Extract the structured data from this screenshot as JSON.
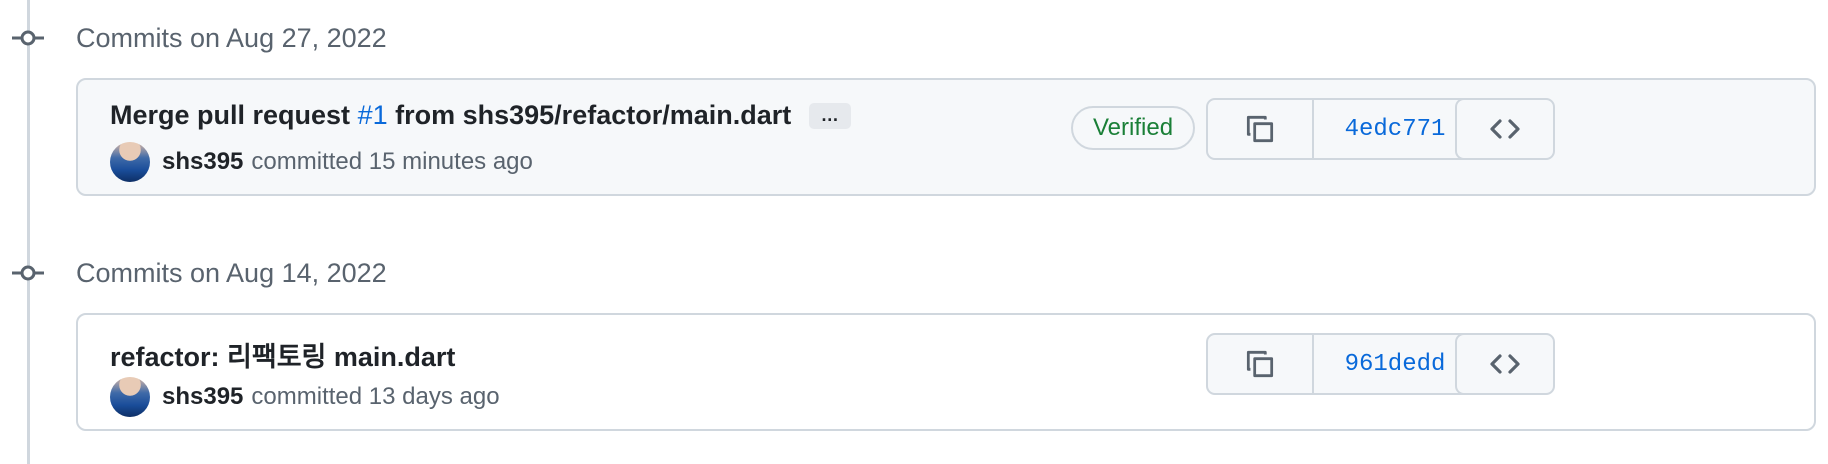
{
  "commit_groups": [
    {
      "date_label": "Commits on Aug 27, 2022",
      "commit": {
        "title_prefix": "Merge pull request ",
        "pr_link": "#1",
        "title_suffix": " from shs395/refactor/main.dart",
        "ellipsis": "…",
        "author": "shs395",
        "committed_text": "committed 15 minutes ago",
        "verified": "Verified",
        "sha": "4edc771"
      }
    },
    {
      "date_label": "Commits on Aug 14, 2022",
      "commit": {
        "title": "refactor: 리팩토링 main.dart",
        "author": "shs395",
        "committed_text": "committed 13 days ago",
        "sha": "961dedd"
      }
    }
  ],
  "colors": {
    "link": "#0969da",
    "verified": "#1a7f37",
    "border": "#d0d7de",
    "muted": "#59636e"
  },
  "icons": {
    "commit_node": "git-commit-icon",
    "copy": "copy-icon",
    "browse": "code-icon"
  }
}
